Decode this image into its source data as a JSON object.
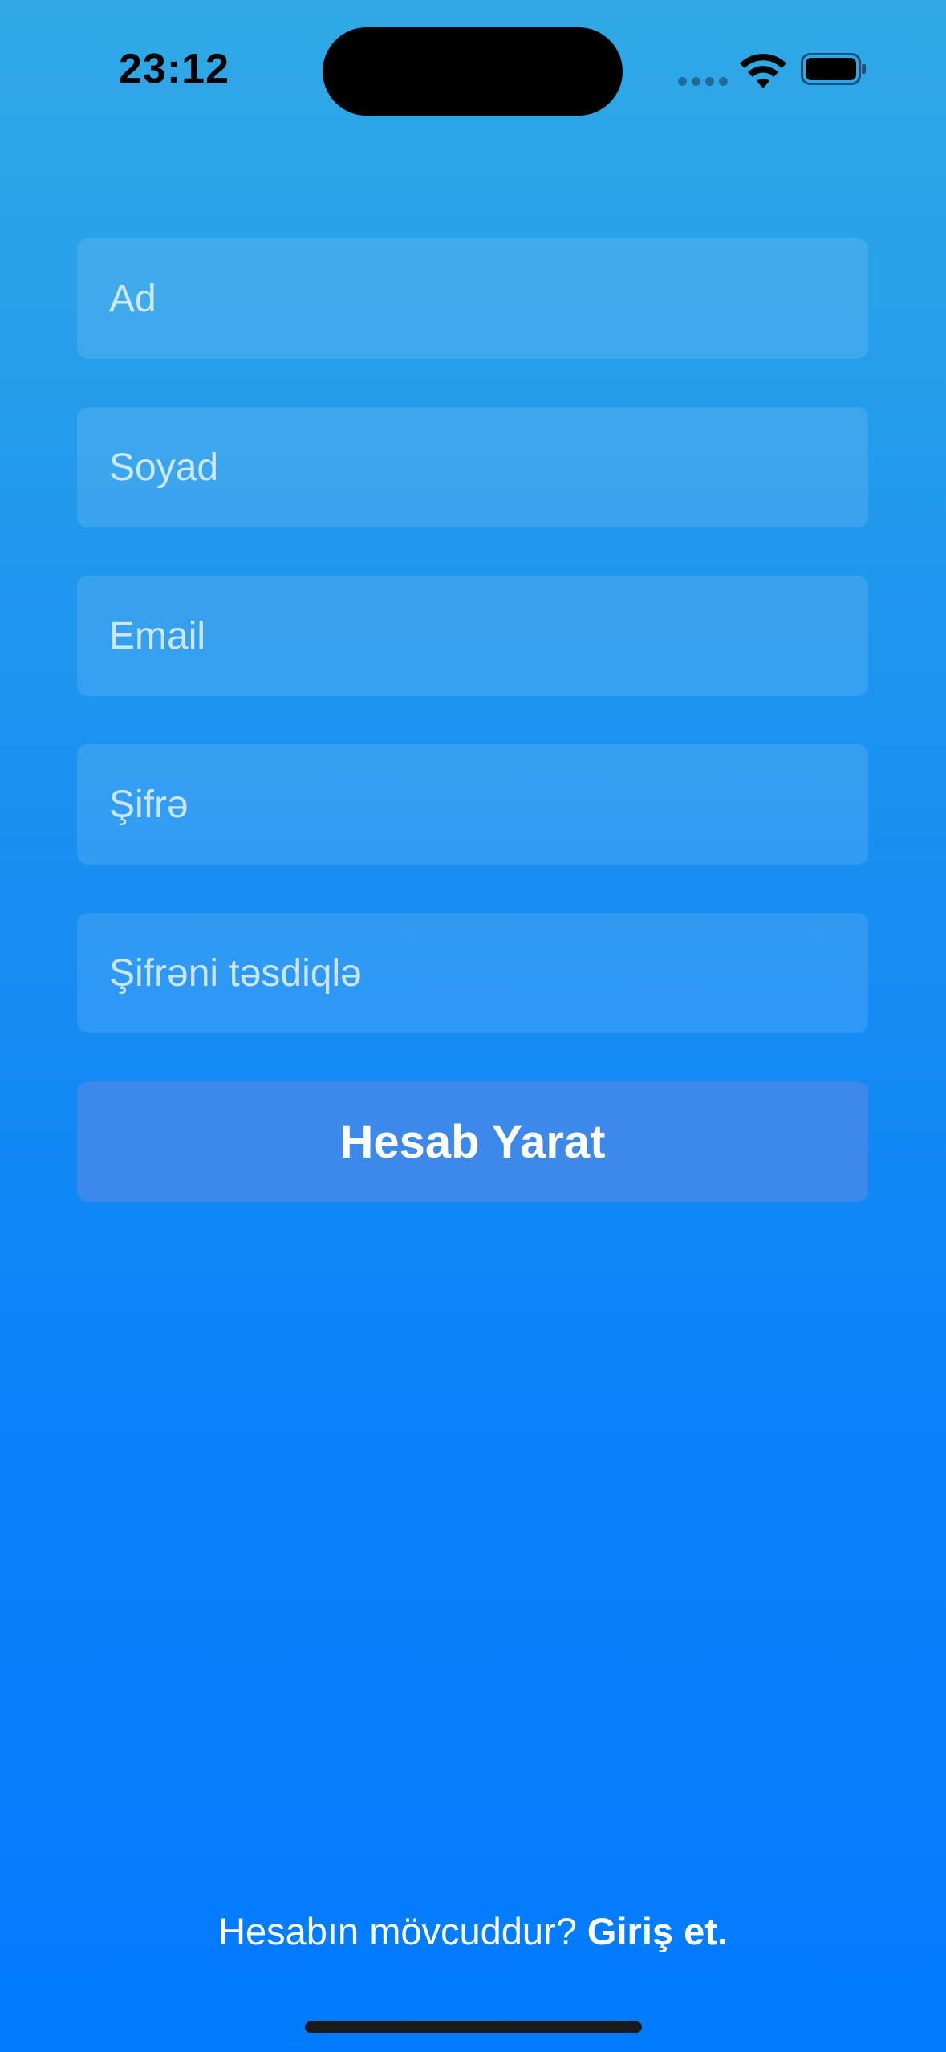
{
  "status_bar": {
    "time": "23:12"
  },
  "form": {
    "first_name_placeholder": "Ad",
    "last_name_placeholder": "Soyad",
    "email_placeholder": "Email",
    "password_placeholder": "Şifrə",
    "confirm_password_placeholder": "Şifrəni təsdiqlə",
    "submit_label": "Hesab Yarat"
  },
  "footer": {
    "prompt": "Hesabın mövcuddur?",
    "login_link": "Giriş et."
  },
  "colors": {
    "background_top": "#30a9e6",
    "background_bottom": "#017bfe",
    "button": "#3c89ea"
  }
}
